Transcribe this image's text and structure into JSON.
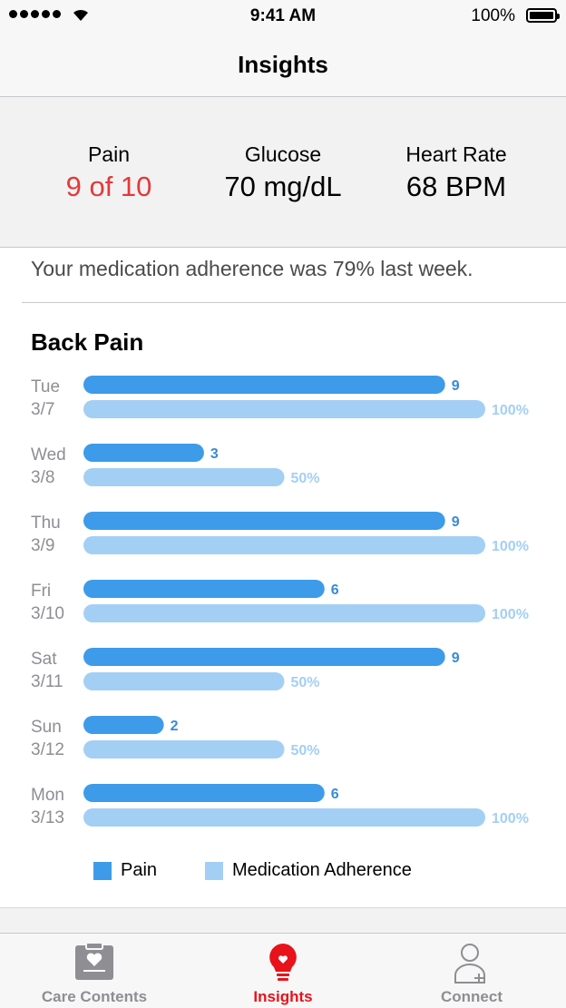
{
  "status_bar": {
    "time": "9:41 AM",
    "battery": "100%"
  },
  "nav": {
    "title": "Insights"
  },
  "metrics": [
    {
      "label": "Pain",
      "value": "9 of 10",
      "color": "#e5383a"
    },
    {
      "label": "Glucose",
      "value": "70 mg/dL"
    },
    {
      "label": "Heart Rate",
      "value": "68 BPM"
    }
  ],
  "adherence_message": "Your medication adherence was 79% last week.",
  "chart": {
    "title": "Back Pain"
  },
  "chart_data": {
    "type": "bar",
    "orientation": "horizontal",
    "title": "Back Pain",
    "categories": [
      {
        "day": "Tue",
        "date": "3/7"
      },
      {
        "day": "Wed",
        "date": "3/8"
      },
      {
        "day": "Thu",
        "date": "3/9"
      },
      {
        "day": "Fri",
        "date": "3/10"
      },
      {
        "day": "Sat",
        "date": "3/11"
      },
      {
        "day": "Sun",
        "date": "3/12"
      },
      {
        "day": "Mon",
        "date": "3/13"
      }
    ],
    "series": [
      {
        "name": "Pain",
        "values": [
          9,
          3,
          9,
          6,
          9,
          2,
          6
        ],
        "labels": [
          "9",
          "3",
          "9",
          "6",
          "9",
          "2",
          "6"
        ],
        "max": 10,
        "color": "#3d9be9"
      },
      {
        "name": "Medication Adherence",
        "values": [
          100,
          50,
          100,
          100,
          50,
          50,
          100
        ],
        "labels": [
          "100%",
          "50%",
          "100%",
          "100%",
          "50%",
          "50%",
          "100%"
        ],
        "max": 100,
        "color": "#a3cff5"
      }
    ],
    "legend": "bottom"
  },
  "legend": [
    {
      "label": "Pain",
      "color": "#3d9be9"
    },
    {
      "label": "Medication Adherence",
      "color": "#a3cff5"
    }
  ],
  "tabs": [
    {
      "label": "Care Contents",
      "icon": "clipboard-heart-icon",
      "active": false
    },
    {
      "label": "Insights",
      "icon": "lightbulb-heart-icon",
      "active": true
    },
    {
      "label": "Connect",
      "icon": "person-plus-icon",
      "active": false
    }
  ],
  "colors": {
    "accent_red": "#e8121b",
    "pain_blue": "#3d9be9",
    "adherence_blue": "#a3cff5",
    "value_red": "#e5383a"
  }
}
